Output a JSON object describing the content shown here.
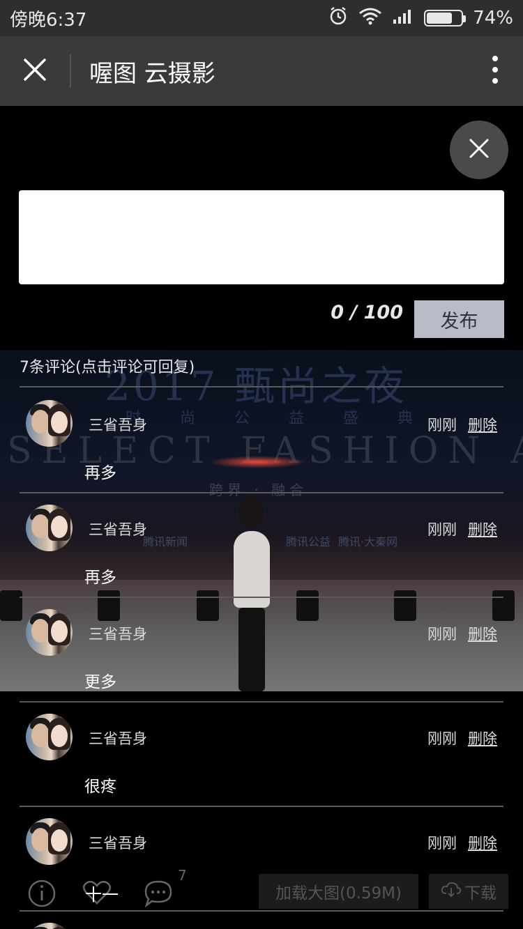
{
  "status_bar": {
    "time": "傍晚6:37",
    "battery": "74%",
    "battery_level": 0.74,
    "icons": [
      "alarm-icon",
      "wifi-icon",
      "signal-icon",
      "battery-icon"
    ]
  },
  "nav": {
    "title": "喔图 云摄影",
    "close_icon": "close-icon",
    "more_icon": "more-vertical-icon"
  },
  "composer": {
    "value": "",
    "counter": "0 / 100",
    "publish_label": "发布"
  },
  "comments_header": "7条评论(点击评论可回复)",
  "background_photo": {
    "headline": "2017 甄尚之夜",
    "subheadline": "时尚公益盛典",
    "awards": "SELECT FASHION AWARDS",
    "tagline": "跨界 · 融合",
    "logo_1": "腾讯新闻",
    "logo_2": "腾讯公益",
    "logo_3": "腾讯·大秦网"
  },
  "comments": [
    {
      "user": "三省吾身",
      "time": "刚刚",
      "delete_label": "删除",
      "text": "再多"
    },
    {
      "user": "三省吾身",
      "time": "刚刚",
      "delete_label": "删除",
      "text": "再多"
    },
    {
      "user": "三省吾身",
      "time": "刚刚",
      "delete_label": "删除",
      "text": "更多"
    },
    {
      "user": "三省吾身",
      "time": "刚刚",
      "delete_label": "删除",
      "text": "很疼"
    },
    {
      "user": "三省吾身",
      "time": "刚刚",
      "delete_label": "删除",
      "text": ""
    }
  ],
  "toolbar": {
    "info_icon": "info-icon",
    "like_icon": "heart-icon",
    "like_count": "十一",
    "comment_icon": "comment-bubble-icon",
    "comment_count": "7",
    "load_label": "加载大图(0.59M)",
    "download_label": "下载",
    "download_icon": "cloud-download-icon"
  }
}
